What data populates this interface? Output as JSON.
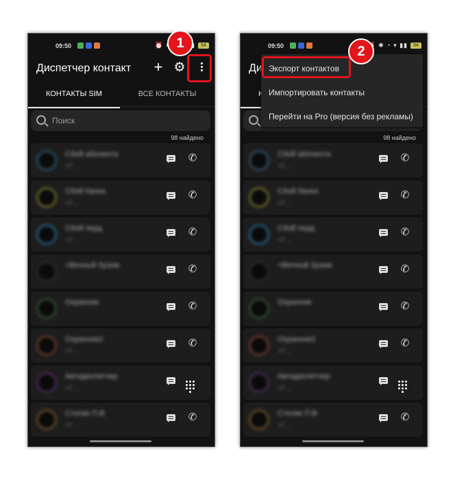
{
  "status_bar": {
    "time": "09:50",
    "icons": "⏰ ✱ ◔ ▾ ▮▮",
    "battery": "54"
  },
  "app": {
    "title": "Диспетчер контакт",
    "tabs": [
      {
        "label": "КОНТАКТЫ SIM"
      },
      {
        "label": "ВСЕ КОНТАКТЫ"
      }
    ],
    "search": {
      "placeholder": "Поиск"
    },
    "found_count": "98 найдено"
  },
  "contacts": [
    {
      "name": "Сбой абонента",
      "number": "+7 ..."
    },
    {
      "name": "Сбой банка",
      "number": "+7 ..."
    },
    {
      "name": "Сбой перд",
      "number": "+7 ..."
    },
    {
      "name": "+Вечный Зузом",
      "number": ""
    },
    {
      "name": "Охранник",
      "number": ""
    },
    {
      "name": "Охранник2",
      "number": "+7 ..."
    },
    {
      "name": "Автодиспетчер",
      "number": "+7 ..."
    },
    {
      "name": "Столик П.В.",
      "number": "+7 ..."
    }
  ],
  "overflow_menu": {
    "items": [
      {
        "label": "Экспорт контактов"
      },
      {
        "label": "Импортировать контакты"
      },
      {
        "label": "Перейти на Pro (версия без рекламы)"
      }
    ]
  },
  "annotations": {
    "step1": "1",
    "step2": "2",
    "highlight_color": "#e3141a"
  },
  "colors": {
    "background": "#121212",
    "surface": "#1d1d1d",
    "accent": "#e3141a"
  }
}
